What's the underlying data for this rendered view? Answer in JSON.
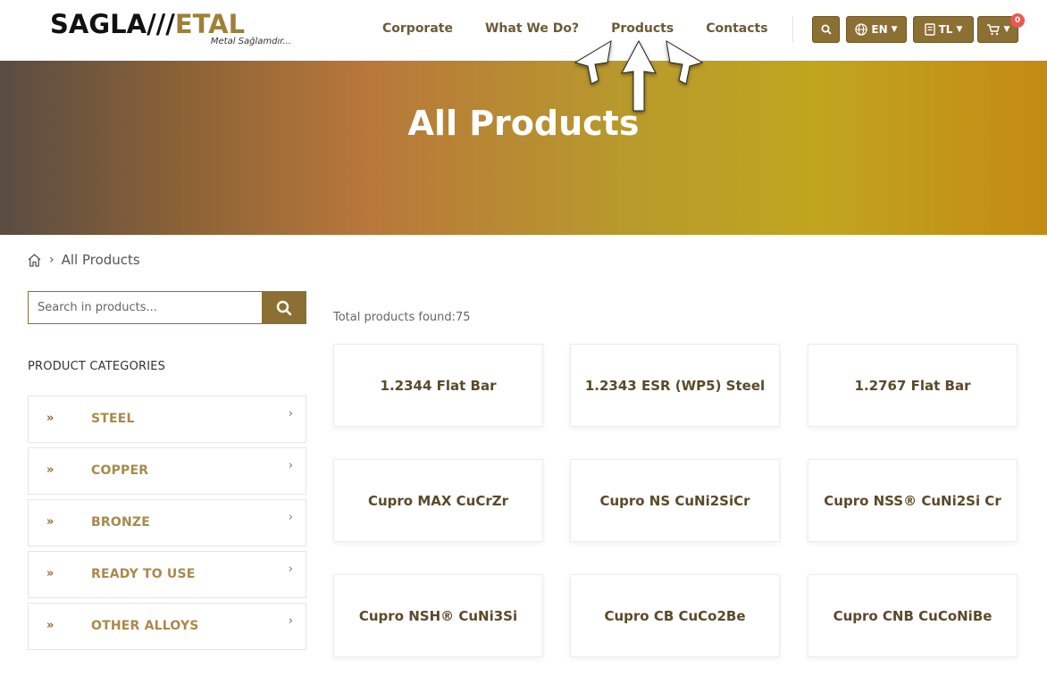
{
  "brand": {
    "logo_dark": "SAGLA",
    "logo_gold": "ETAL",
    "logo_slashes": "///",
    "tagline": "Metal Sağlamdır..."
  },
  "nav": {
    "items": [
      "Corporate",
      "What We Do?",
      "Products",
      "Contacts"
    ]
  },
  "header_buttons": {
    "search_icon": "search-icon",
    "language": "EN",
    "currency": "TL",
    "cart_count": "0"
  },
  "hero": {
    "title": "All Products"
  },
  "breadcrumb": {
    "current": "All Products"
  },
  "search": {
    "placeholder": "Search in products..."
  },
  "categories": {
    "heading": "PRODUCT CATEGORIES",
    "items": [
      "STEEL",
      "COPPER",
      "BRONZE",
      "READY TO USE",
      "OTHER ALLOYS"
    ]
  },
  "products": {
    "total_label": "Total products found:75",
    "items": [
      "1.2344 Flat Bar",
      "1.2343 ESR (WP5) Steel",
      "1.2767 Flat Bar",
      "Cupro MAX CuCrZr",
      "Cupro NS CuNi2SiCr",
      "Cupro NSS® CuNi2Si Cr",
      "Cupro NSH® CuNi3Si",
      "Cupro CB CuCo2Be",
      "Cupro CNB CuCoNiBe"
    ]
  },
  "colors": {
    "accent": "#8c6f33",
    "nav_text": "#6b5a35",
    "badge": "#e85a4f"
  }
}
